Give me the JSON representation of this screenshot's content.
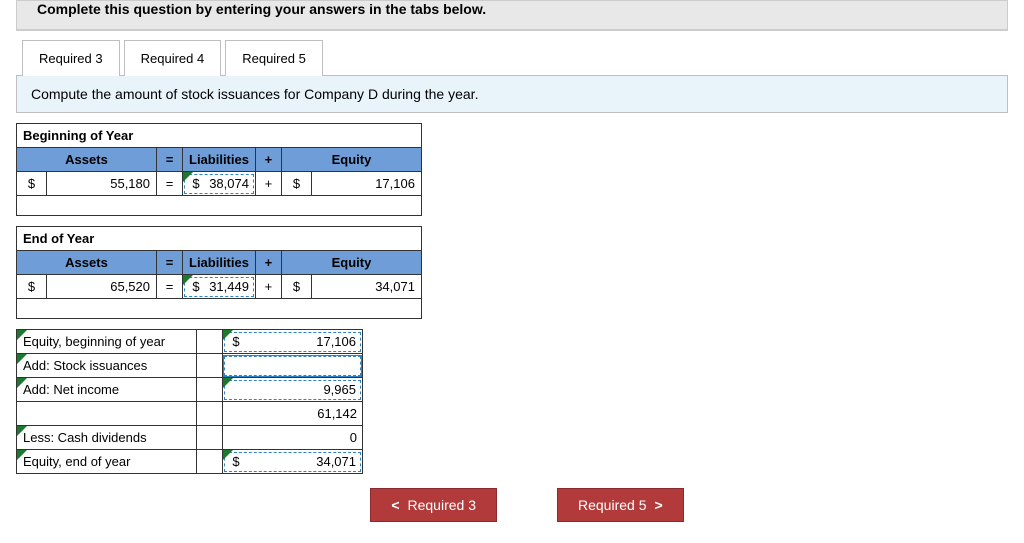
{
  "instruction": "Complete this question by entering your answers in the tabs below.",
  "tabs": {
    "t1": "Required 3",
    "t2": "Required 4",
    "t3": "Required 5"
  },
  "prompt": "Compute the amount of stock issuances for Company D during the year.",
  "beginning": {
    "title": "Beginning of Year",
    "headers": {
      "assets": "Assets",
      "eq": "=",
      "liab": "Liabilities",
      "plus": "+",
      "equity": "Equity"
    },
    "row": {
      "assets_cur": "$",
      "assets_val": "55,180",
      "op1": "=",
      "liab_cur": "$",
      "liab_val": "38,074",
      "op2": "+",
      "equity_cur": "$",
      "equity_val": "17,106"
    }
  },
  "end": {
    "title": "End of Year",
    "headers": {
      "assets": "Assets",
      "eq": "=",
      "liab": "Liabilities",
      "plus": "+",
      "equity": "Equity"
    },
    "row": {
      "assets_cur": "$",
      "assets_val": "65,520",
      "op1": "=",
      "liab_cur": "$",
      "liab_val": "31,449",
      "op2": "+",
      "equity_cur": "$",
      "equity_val": "34,071"
    }
  },
  "roll": {
    "r1": {
      "label": "Equity, beginning of year",
      "cur": "$",
      "val": "17,106"
    },
    "r2": {
      "label": "Add: Stock issuances",
      "cur": "",
      "val": ""
    },
    "r3": {
      "label": "Add: Net income",
      "cur": "",
      "val": "9,965"
    },
    "r4": {
      "label": "",
      "cur": "",
      "val": "61,142"
    },
    "r5": {
      "label": "Less: Cash dividends",
      "cur": "",
      "val": "0"
    },
    "r6": {
      "label": "Equity, end of year",
      "cur": "$",
      "val": "34,071"
    }
  },
  "nav": {
    "prev_arrow": "<",
    "prev": "Required 3",
    "next": "Required 5",
    "next_arrow": ">"
  }
}
